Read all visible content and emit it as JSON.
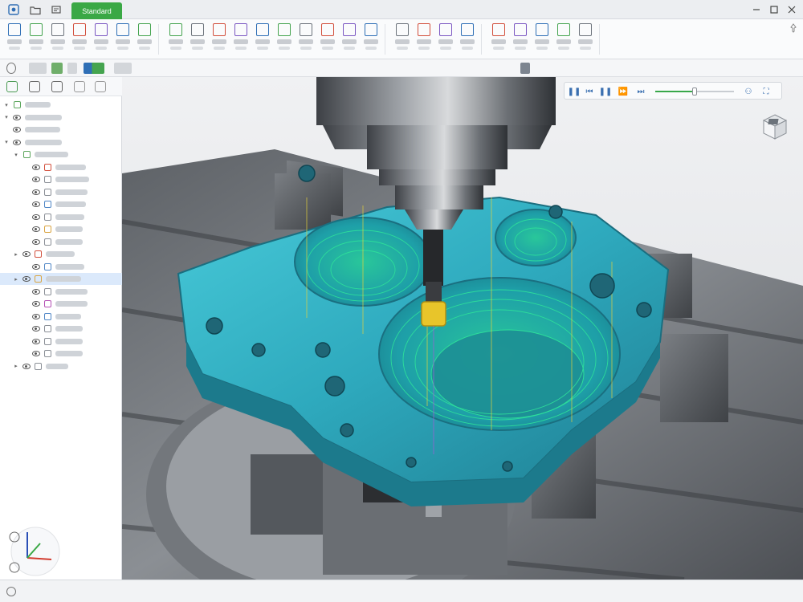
{
  "titlebar": {
    "active_tab_label": "Standard",
    "icons": [
      "home-icon",
      "folder-icon",
      "layers-icon"
    ],
    "window_controls": [
      "minimize-icon",
      "restore-icon",
      "close-icon"
    ]
  },
  "ribbon": {
    "groups": [
      {
        "name": "file",
        "buttons": [
          "new-icon",
          "open-icon",
          "save-icon",
          "refresh-icon",
          "tools-icon",
          "doc-icon",
          "report-icon"
        ]
      },
      {
        "name": "operations",
        "buttons": [
          "viewport-icon",
          "select-icon",
          "machine-icon",
          "tool-icon",
          "holder-icon",
          "stock-icon",
          "fixture-icon",
          "setup-icon",
          "frame-icon",
          "target-icon"
        ]
      },
      {
        "name": "simulation",
        "buttons": [
          "globe-icon",
          "cycle-icon",
          "simulate-icon",
          "section-icon"
        ]
      },
      {
        "name": "analysis",
        "buttons": [
          "measure-icon",
          "collision-icon",
          "compare-icon",
          "optimize-icon",
          "export-icon"
        ]
      }
    ],
    "pin_icon": "pin-icon"
  },
  "toolbar2": {
    "icons": [
      "search-icon",
      "filter-icon",
      "display-icon",
      "color-icon",
      "view-icon",
      "camera-icon"
    ]
  },
  "tree": {
    "toolbar_icons": [
      "tree-icon",
      "list-icon",
      "settings-icon",
      "cube-icon",
      "star-icon"
    ],
    "rows": [
      {
        "indent": 0,
        "twisty": "▾",
        "icon": "folder-icon",
        "color": "#5aa55b",
        "label_w": 32,
        "selected": false,
        "eye": false
      },
      {
        "indent": 0,
        "twisty": "▾",
        "icon": "",
        "color": "",
        "label_w": 46,
        "selected": false,
        "eye": true
      },
      {
        "indent": 0,
        "twisty": "",
        "icon": "",
        "color": "",
        "label_w": 44,
        "selected": false,
        "eye": true
      },
      {
        "indent": 0,
        "twisty": "▾",
        "icon": "",
        "color": "",
        "label_w": 46,
        "selected": false,
        "eye": true
      },
      {
        "indent": 1,
        "twisty": "▾",
        "icon": "setup-icon",
        "color": "#5aa55b",
        "label_w": 42,
        "selected": false,
        "eye": false
      },
      {
        "indent": 2,
        "twisty": "",
        "icon": "op-icon",
        "color": "#d24f3c",
        "label_w": 38,
        "selected": false,
        "eye": true
      },
      {
        "indent": 2,
        "twisty": "",
        "icon": "op-icon",
        "color": "#8a8f96",
        "label_w": 42,
        "selected": false,
        "eye": true
      },
      {
        "indent": 2,
        "twisty": "",
        "icon": "op-icon",
        "color": "#8a8f96",
        "label_w": 40,
        "selected": false,
        "eye": true
      },
      {
        "indent": 2,
        "twisty": "",
        "icon": "op-icon",
        "color": "#4f86c6",
        "label_w": 38,
        "selected": false,
        "eye": true
      },
      {
        "indent": 2,
        "twisty": "",
        "icon": "op-icon",
        "color": "#8a8f96",
        "label_w": 36,
        "selected": false,
        "eye": true
      },
      {
        "indent": 2,
        "twisty": "",
        "icon": "op-icon",
        "color": "#d9a441",
        "label_w": 34,
        "selected": false,
        "eye": true
      },
      {
        "indent": 2,
        "twisty": "",
        "icon": "op-icon",
        "color": "#8a8f96",
        "label_w": 34,
        "selected": false,
        "eye": true
      },
      {
        "indent": 1,
        "twisty": "▸",
        "icon": "op-icon",
        "color": "#d24f3c",
        "label_w": 36,
        "selected": false,
        "eye": true
      },
      {
        "indent": 2,
        "twisty": "",
        "icon": "op-icon",
        "color": "#4f86c6",
        "label_w": 36,
        "selected": false,
        "eye": true
      },
      {
        "indent": 1,
        "twisty": "▸",
        "icon": "op-icon",
        "color": "#d9a441",
        "label_w": 44,
        "selected": true,
        "eye": true
      },
      {
        "indent": 2,
        "twisty": "",
        "icon": "op-icon",
        "color": "#8a8f96",
        "label_w": 40,
        "selected": false,
        "eye": true
      },
      {
        "indent": 2,
        "twisty": "",
        "icon": "op-icon",
        "color": "#b44fb4",
        "label_w": 40,
        "selected": false,
        "eye": true
      },
      {
        "indent": 2,
        "twisty": "",
        "icon": "op-icon",
        "color": "#4f86c6",
        "label_w": 32,
        "selected": false,
        "eye": true
      },
      {
        "indent": 2,
        "twisty": "",
        "icon": "op-icon",
        "color": "#8a8f96",
        "label_w": 34,
        "selected": false,
        "eye": true
      },
      {
        "indent": 2,
        "twisty": "",
        "icon": "op-icon",
        "color": "#8a8f96",
        "label_w": 34,
        "selected": false,
        "eye": true
      },
      {
        "indent": 2,
        "twisty": "",
        "icon": "op-icon",
        "color": "#8a8f96",
        "label_w": 34,
        "selected": false,
        "eye": true
      },
      {
        "indent": 1,
        "twisty": "▸",
        "icon": "op-icon",
        "color": "#8a8f96",
        "label_w": 28,
        "selected": false,
        "eye": true
      }
    ]
  },
  "playback": {
    "buttons": [
      "pause-icon",
      "step-back-icon",
      "play-pause-icon",
      "fast-forward-icon",
      "skip-end-icon"
    ],
    "progress": 0.5,
    "extra_icons": [
      "collision-icon",
      "fit-icon",
      "settings-icon"
    ]
  },
  "colors": {
    "accent_green": "#3aa845",
    "part_cyan": "#37b8c8",
    "toolpath_green": "#2ee29a",
    "toolpath_yellow": "#e6d33b",
    "cutter_gold": "#e8c52a",
    "steel": "#8d9196",
    "selection": "#dbe9fb"
  }
}
